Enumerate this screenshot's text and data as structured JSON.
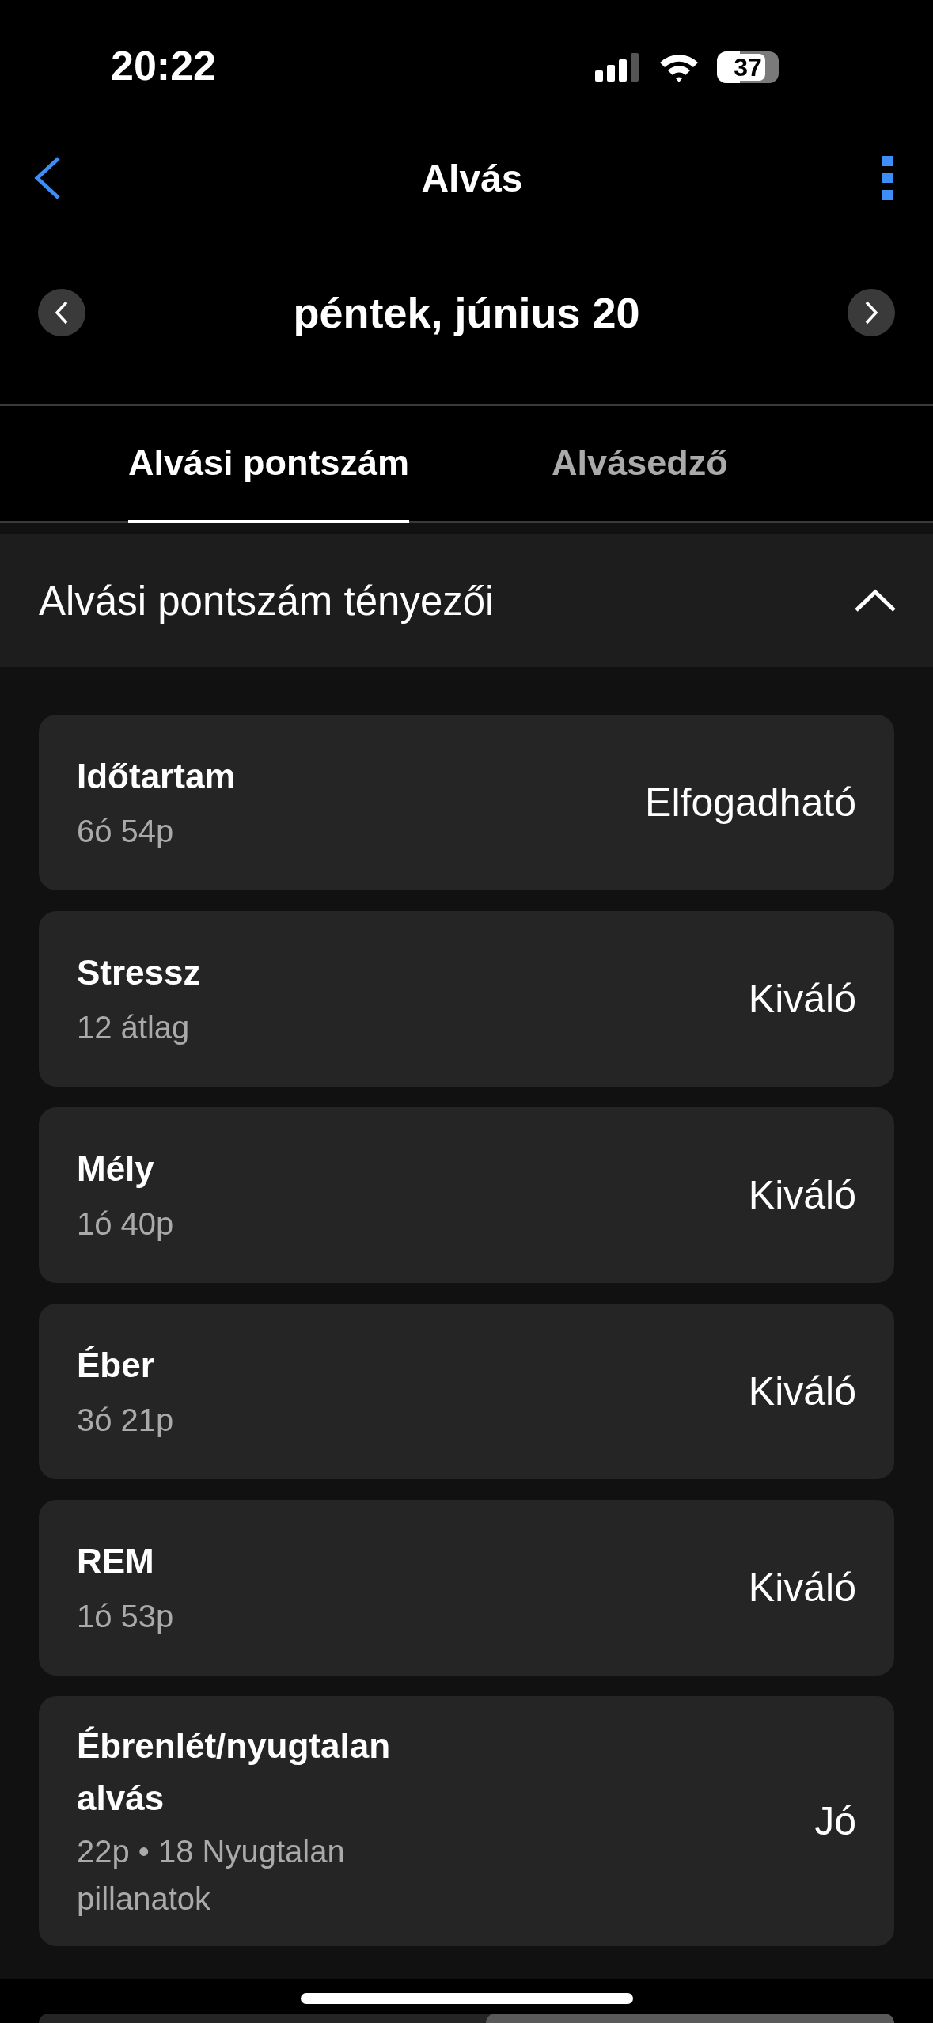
{
  "status_bar": {
    "time": "20:22",
    "battery": "37"
  },
  "header": {
    "title": "Alvás"
  },
  "date_nav": {
    "date": "péntek, június 20"
  },
  "tabs": [
    {
      "label": "Alvási pontszám",
      "selected": true
    },
    {
      "label": "Alvásedző",
      "selected": false
    }
  ],
  "section": {
    "title": "Alvási pontszám tényezői",
    "expanded": true
  },
  "factors": [
    {
      "name": "Időtartam",
      "detail": "6ó 54p",
      "rating": "Elfogadható"
    },
    {
      "name": "Stressz",
      "detail": "12 átlag",
      "rating": "Kiváló"
    },
    {
      "name": "Mély",
      "detail": "1ó 40p",
      "rating": "Kiváló"
    },
    {
      "name": "Éber",
      "detail": "3ó 21p",
      "rating": "Kiváló"
    },
    {
      "name": "REM",
      "detail": "1ó 53p",
      "rating": "Kiváló"
    },
    {
      "name": "Ébrenlét/nyugtalan alvás",
      "detail": "22p • 18 Nyugtalan pillanatok",
      "rating": "Jó"
    }
  ]
}
